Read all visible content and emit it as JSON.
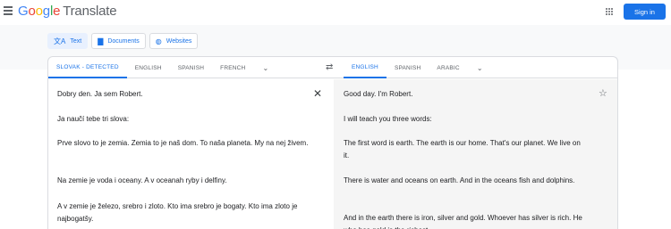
{
  "header": {
    "logo_letters": [
      {
        "ch": "G",
        "color": "#4285f4"
      },
      {
        "ch": "o",
        "color": "#ea4335"
      },
      {
        "ch": "o",
        "color": "#fbbc05"
      },
      {
        "ch": "g",
        "color": "#4285f4"
      },
      {
        "ch": "l",
        "color": "#34a853"
      },
      {
        "ch": "e",
        "color": "#ea4335"
      }
    ],
    "product": "Translate",
    "signin_label": "Sign in"
  },
  "modes": {
    "text_label": "Text",
    "documents_label": "Documents",
    "websites_label": "Websites"
  },
  "source_langs": {
    "detected": "SLOVAK - DETECTED",
    "lang1": "ENGLISH",
    "lang2": "SPANISH",
    "lang3": "FRENCH"
  },
  "target_langs": {
    "lang1": "ENGLISH",
    "lang2": "SPANISH",
    "lang3": "ARABIC"
  },
  "source_text": [
    "Dobry den. Ja sem Robert.",
    "Ja naučí tebe tri slova:",
    "Prve slovo to je zemia. Zemia to je naš dom. To naša planeta. My na nej živem.",
    "Na zemie je voda i oceany. A v oceanah ryby i delfiny.",
    "A v zemie je železo, srebro i zloto. Kto ima srebro je bogaty. Kto ima zloto je najbogatšy."
  ],
  "target_text": [
    "Good day. I'm Robert.",
    "I will teach you three words:",
    "The first word is earth. The earth is our home. That's our planet. We live on it.",
    "There is water and oceans on earth. And in the oceans fish and dolphins.",
    "And in the earth there is iron, silver and gold. Whoever has silver is rich. He who has gold is the richest."
  ],
  "colors": {
    "accent": "#1a73e8",
    "target_bg": "#f5f5f5"
  }
}
